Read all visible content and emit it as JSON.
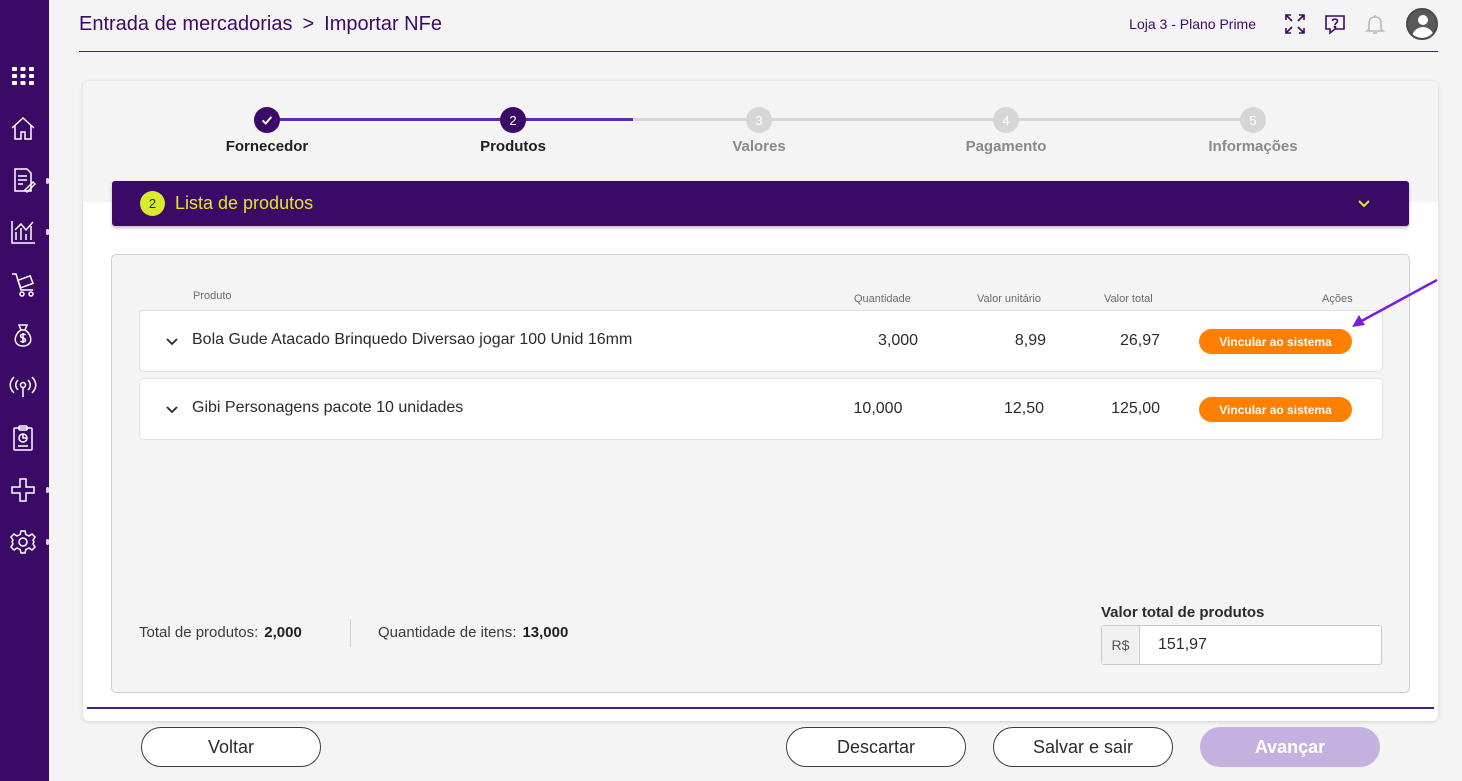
{
  "colors": {
    "brand_purple": "#3b0a66",
    "accent_yellow": "#d9ec2c",
    "action_orange": "#ff7f00",
    "disabled_primary": "#c4b1e0",
    "annotation_arrow": "#7a1de0"
  },
  "sidebar": {
    "items": [
      {
        "icon": "apps-grid-icon"
      },
      {
        "icon": "home-icon"
      },
      {
        "icon": "document-edit-icon"
      },
      {
        "icon": "chart-icon"
      },
      {
        "icon": "cart-icon"
      },
      {
        "icon": "money-bag-icon"
      },
      {
        "icon": "broadcast-icon"
      },
      {
        "icon": "report-icon"
      },
      {
        "icon": "integrations-icon"
      },
      {
        "icon": "settings-icon"
      }
    ]
  },
  "header": {
    "breadcrumb": [
      "Entrada de mercadorias",
      "Importar NFe"
    ],
    "separator": ">",
    "store_label": "Loja 3 - Plano Prime",
    "icons": [
      "fullscreen-icon",
      "help-chat-icon",
      "bell-icon",
      "user-avatar-icon"
    ]
  },
  "stepper": {
    "steps": [
      {
        "number": "1",
        "label": "Fornecedor",
        "state": "completed"
      },
      {
        "number": "2",
        "label": "Produtos",
        "state": "current"
      },
      {
        "number": "3",
        "label": "Valores",
        "state": "pending"
      },
      {
        "number": "4",
        "label": "Pagamento",
        "state": "pending"
      },
      {
        "number": "5",
        "label": "Informações",
        "state": "pending"
      }
    ]
  },
  "section": {
    "badge": "2",
    "title": "Lista de produtos"
  },
  "table": {
    "columns": [
      "Produto",
      "Quantidade",
      "Valor unitário",
      "Valor total",
      "Ações"
    ],
    "rows": [
      {
        "product": "Bola Gude Atacado Brinquedo Diversao jogar 100 Unid 16mm",
        "quantity": "3,000",
        "unit_value": "8,99",
        "total_value": "26,97",
        "action": "Vincular ao sistema"
      },
      {
        "product": "Gibi Personagens pacote 10 unidades",
        "quantity": "10,000",
        "unit_value": "12,50",
        "total_value": "125,00",
        "action": "Vincular ao sistema"
      }
    ]
  },
  "summary": {
    "total_products_label": "Total de produtos:",
    "total_products_value": "2,000",
    "items_quantity_label": "Quantidade de itens:",
    "items_quantity_value": "13,000",
    "total_value_label": "Valor total de produtos",
    "currency": "R$",
    "total_value": "151,97"
  },
  "footer": {
    "back": "Voltar",
    "discard": "Descartar",
    "save_exit": "Salvar e sair",
    "next": "Avançar"
  }
}
